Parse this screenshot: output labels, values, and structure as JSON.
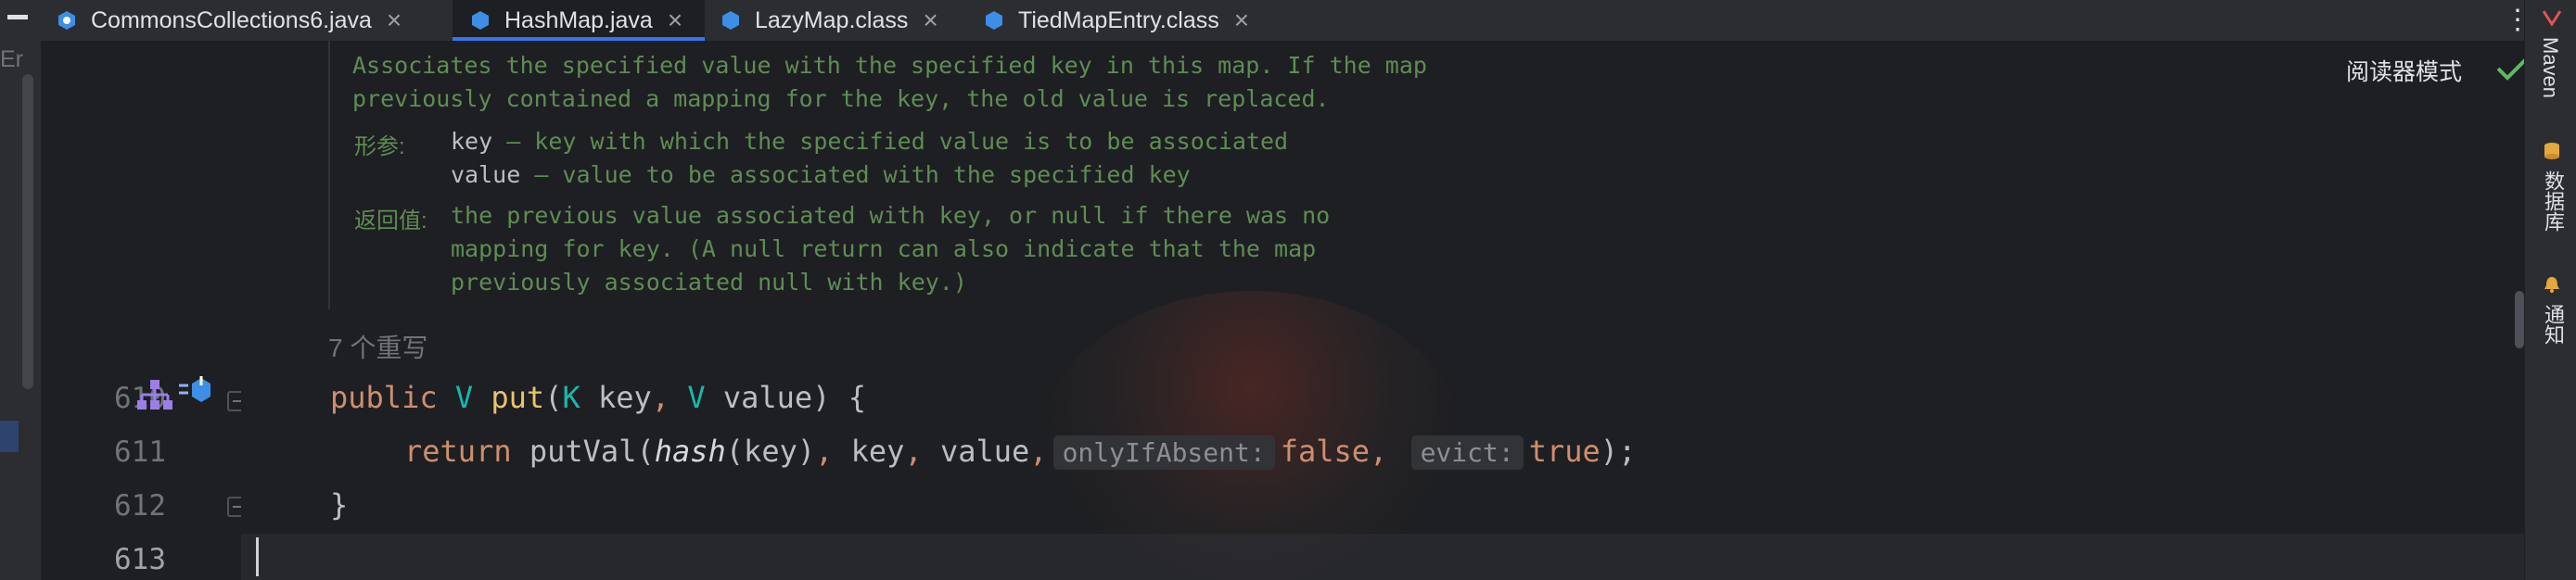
{
  "tabs": [
    {
      "label": "CommonsCollections6.java",
      "icon": "java-class-icon",
      "active": false
    },
    {
      "label": "HashMap.java",
      "icon": "java-class-icon",
      "active": true
    },
    {
      "label": "LazyMap.class",
      "icon": "class-file-icon",
      "active": false
    },
    {
      "label": "TiedMapEntry.class",
      "icon": "class-file-icon",
      "active": false
    }
  ],
  "tab_close_glyph": "×",
  "more_glyph": "⋮",
  "left_strip_text": "Er",
  "reader_mode_label": "阅读器模式",
  "right_tools": {
    "maven": "Maven",
    "database": "数据库",
    "notifications": "通知"
  },
  "doc": {
    "line1": "Associates the specified value with the specified key in this map. If the map",
    "line2": "previously contained a mapping for the key, the old value is replaced.",
    "params_label": "形参:",
    "param1_name": "key",
    "param1_desc": " – key with which the specified value is to be associated",
    "param2_name": "value",
    "param2_desc": " – value to be associated with the specified key",
    "returns_label": "返回值:",
    "returns1": "the previous value associated with key, or null if there was no",
    "returns2": "mapping for key. (A null return can also indicate that the map",
    "returns3": "previously associated null with key.)"
  },
  "overrides_hint": "7 个重写",
  "line_numbers": [
    "610",
    "611",
    "612",
    "613"
  ],
  "code": {
    "l610": {
      "kw": "public",
      "t1": "V",
      "name": "put",
      "p1": "(",
      "t2": "K",
      "a1": " key",
      "c1": ",",
      "t3": "V",
      "a2": " value",
      "end": ") {"
    },
    "l611": {
      "kw": "return",
      "call": "putVal",
      "p1": "(",
      "hash": "hash",
      "a1": "(key)",
      "c1": ",",
      "a2": " key",
      "c2": ",",
      "a3": " value",
      "c3": ",",
      "hint1": "onlyIfAbsent:",
      "v1": "false",
      "c4": ",",
      "hint2": "evict:",
      "v2": "true",
      "end": ");"
    },
    "l612": {
      "brace": "}"
    }
  },
  "colors": {
    "background": "#1e1f22",
    "keyword": "#cf8e6d",
    "doc": "#5f8c55",
    "accent": "#3574f0"
  }
}
